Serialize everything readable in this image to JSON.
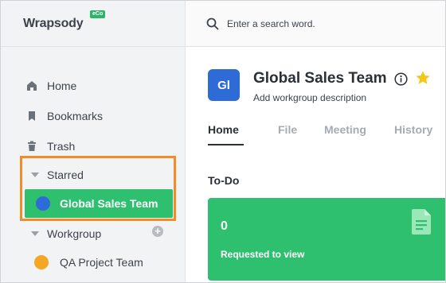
{
  "app": {
    "name": "Wrapsody",
    "badge": "eCo"
  },
  "search": {
    "placeholder": "Enter a search word."
  },
  "sidebar": {
    "items": [
      {
        "label": "Home",
        "icon": "home-icon"
      },
      {
        "label": "Bookmarks",
        "icon": "bookmark-icon"
      },
      {
        "label": "Trash",
        "icon": "trash-icon"
      }
    ],
    "starred": {
      "label": "Starred",
      "items": [
        {
          "label": "Global Sales Team",
          "color": "#2f6bd6",
          "active": true
        }
      ]
    },
    "workgroup": {
      "label": "Workgroup",
      "add_icon": "plus-icon",
      "items": [
        {
          "label": "QA Project Team",
          "color": "#f5a623"
        }
      ]
    }
  },
  "workgroup": {
    "initials": "Gl",
    "name": "Global Sales Team",
    "description": "Add workgroup description",
    "info_icon": "info-icon",
    "star_icon": "star-icon",
    "tabs": [
      {
        "label": "Home",
        "active": true
      },
      {
        "label": "File",
        "active": false
      },
      {
        "label": "Meeting",
        "active": false
      },
      {
        "label": "History",
        "active": false
      }
    ]
  },
  "todo": {
    "title": "To-Do",
    "card": {
      "count": "0",
      "label": "Requested to view",
      "icon": "document-icon"
    }
  },
  "colors": {
    "accent_green": "#2ec06e",
    "highlight_orange": "#f28c28",
    "avatar_blue": "#2f6bd6",
    "star_yellow": "#f5c518"
  }
}
